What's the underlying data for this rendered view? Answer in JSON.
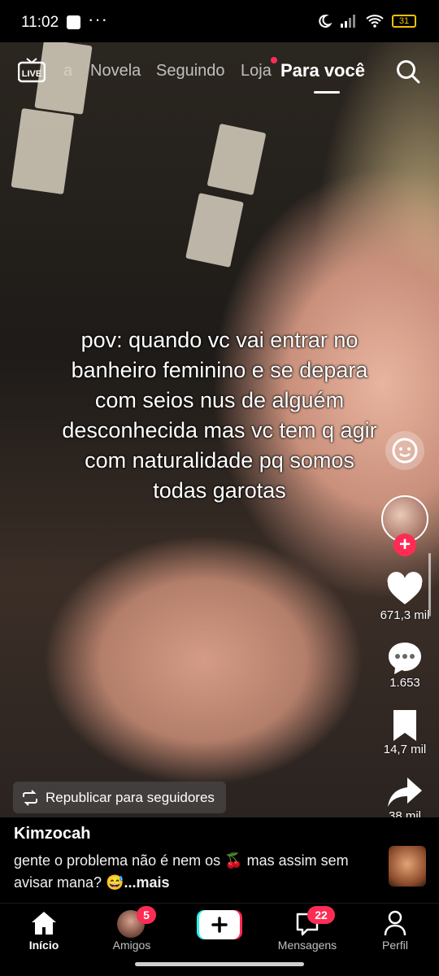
{
  "status_bar": {
    "time": "11:02",
    "more": "···",
    "battery": "31"
  },
  "top_nav": {
    "live_label": "LIVE",
    "tabs": [
      {
        "label": "a"
      },
      {
        "label": "Novela"
      },
      {
        "label": "Seguindo"
      },
      {
        "label": "Loja"
      },
      {
        "label": "Para você"
      }
    ]
  },
  "video": {
    "overlay_text": "pov: quando vc vai entrar no banheiro feminino e se depara com seios nus de alguém desconhecida mas vc tem q agir com naturalidade pq somos todas garotas"
  },
  "actions": {
    "likes": "671,3 mil",
    "comments": "1.653",
    "saves": "14,7 mil",
    "shares": "38 mil",
    "follow_symbol": "+"
  },
  "republish_label": "Republicar para seguidores",
  "post": {
    "author": "Kimzocah",
    "caption": "gente o problema não é nem os 🍒 mas assim sem avisar mana? 😅",
    "more": "...mais"
  },
  "bottom_nav": {
    "items": [
      {
        "label": "Início"
      },
      {
        "label": "Amigos",
        "badge": "5"
      },
      {
        "label": ""
      },
      {
        "label": "Mensagens",
        "badge": "22"
      },
      {
        "label": "Perfil"
      }
    ]
  },
  "colors": {
    "accent": "#fe2c55",
    "battery": "#f2c200"
  }
}
